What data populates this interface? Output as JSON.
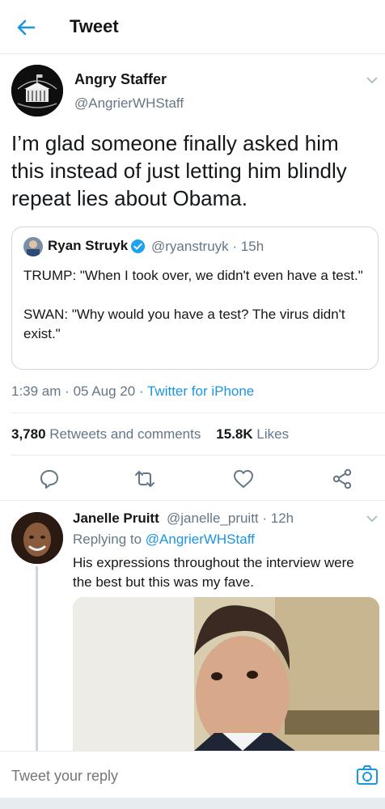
{
  "header": {
    "title": "Tweet"
  },
  "tweet": {
    "author_name": "Angry Staffer",
    "author_handle": "@AngrierWHStaff",
    "text": "I’m glad someone finally asked him this instead of just letting him blindly repeat lies about Obama.",
    "time": "1:39 am",
    "date": "05 Aug 20",
    "separator": "·",
    "source": "Twitter for iPhone",
    "retweets_count": "3,780",
    "retweets_label": "Retweets and comments",
    "likes_count": "15.8K",
    "likes_label": "Likes"
  },
  "quoted": {
    "author_name": "Ryan Struyk",
    "author_handle": "@ryanstruyk",
    "time": "· 15h",
    "line1": "TRUMP: \"When I took over, we didn't even have a test.\"",
    "line2": "SWAN: \"Why would you have a test? The virus didn't exist.\""
  },
  "actions": {
    "reply_icon": "reply-icon",
    "retweet_icon": "retweet-icon",
    "like_icon": "heart-icon",
    "share_icon": "share-icon"
  },
  "reply": {
    "author_name": "Janelle Pruitt",
    "author_handle": "@janelle_pruitt",
    "time": "· 12h",
    "replying_label": "Replying to",
    "replying_to": "@AngrierWHStaff",
    "text": "His expressions throughout the interview were the best but this was my fave."
  },
  "compose": {
    "placeholder": "Tweet your reply"
  },
  "colors": {
    "accent": "#1b95e0",
    "muted": "#657786",
    "border": "#e6ecf0"
  }
}
